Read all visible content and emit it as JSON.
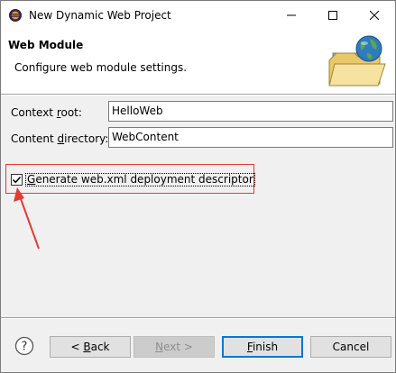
{
  "window": {
    "title": "New Dynamic Web Project",
    "icon": "eclipse-icon",
    "controls": [
      "minimize-icon",
      "maximize-icon",
      "close-icon"
    ]
  },
  "header": {
    "title": "Web Module",
    "description": "Configure web module settings.",
    "icon": "web-project-folder-globe-icon"
  },
  "form": {
    "context_root": {
      "label_pre": "Context ",
      "label_u": "r",
      "label_post": "oot:",
      "value": "HelloWeb"
    },
    "content_directory": {
      "label_pre": "Content ",
      "label_u": "d",
      "label_post": "irectory:",
      "value": "WebContent"
    },
    "generate_descriptor": {
      "label_u": "G",
      "label_post": "enerate web.xml deployment descriptor",
      "checked": true
    }
  },
  "annotation": {
    "highlight_color": "#e53935",
    "arrow_color": "#e53935"
  },
  "buttons": {
    "help_icon": "help-icon",
    "back": {
      "pre": "< ",
      "u": "B",
      "post": "ack",
      "enabled": true
    },
    "next": {
      "pre": "",
      "u": "N",
      "post": "ext >",
      "enabled": false
    },
    "finish": {
      "pre": "",
      "u": "F",
      "post": "inish",
      "enabled": true,
      "default": true
    },
    "cancel": {
      "label": "Cancel",
      "enabled": true
    }
  }
}
